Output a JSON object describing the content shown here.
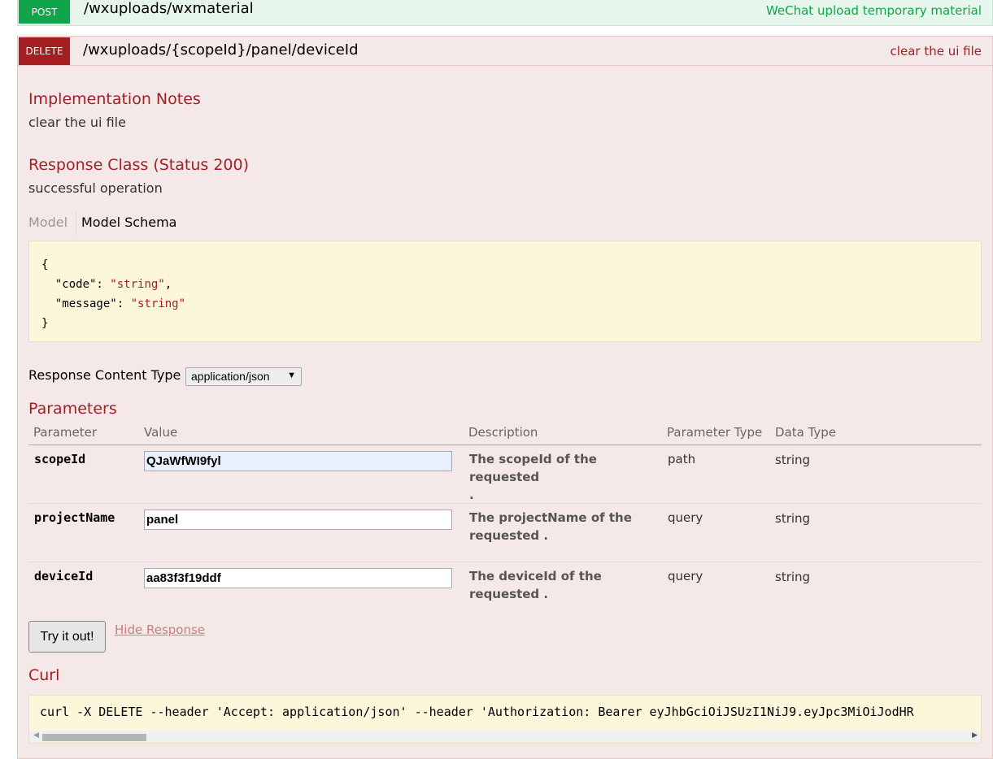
{
  "post_op": {
    "method": "POST",
    "path": "/wxuploads/wxmaterial",
    "summary": "WeChat upload temporary material"
  },
  "delete_op": {
    "method": "DELETE",
    "path": "/wxuploads/{scopeId}/panel/deviceId",
    "summary": "clear the ui file",
    "impl_notes_title": "Implementation Notes",
    "impl_notes_text": "clear the ui file",
    "response_class_title": "Response Class (Status 200)",
    "response_class_text": "successful operation",
    "tabs": {
      "model": "Model",
      "schema": "Model Schema"
    },
    "schema_lines": [
      "{",
      "  \"code\": ",
      "\"string\"",
      ",",
      "  \"message\": ",
      "\"string\"",
      "}"
    ],
    "response_content_type_label": "Response Content Type",
    "response_content_type_value": "application/json",
    "parameters_title": "Parameters",
    "param_headers": {
      "parameter": "Parameter",
      "value": "Value",
      "description": "Description",
      "parameter_type": "Parameter Type",
      "data_type": "Data Type"
    },
    "params": [
      {
        "name": "scopeId",
        "value": "QJaWfWI9fyl",
        "desc_line1": "The scopeId of the requested",
        "desc_line2": ".",
        "type": "path",
        "data_type": "string"
      },
      {
        "name": "projectName",
        "value": "panel",
        "desc_line1": "The projectName of the",
        "desc_line2": "requested .",
        "type": "query",
        "data_type": "string"
      },
      {
        "name": "deviceId",
        "value": "aa83f3f19ddf",
        "desc_line1": "The deviceId of the",
        "desc_line2": "requested .",
        "type": "query",
        "data_type": "string"
      }
    ],
    "try_button": "Try it out!",
    "hide_response": "Hide Response",
    "curl_title": "Curl",
    "curl_text": "curl -X DELETE --header 'Accept: application/json' --header 'Authorization: Bearer eyJhbGciOiJSUzI1NiJ9.eyJpc3MiOiJodHR"
  },
  "colors": {
    "post": "#10a54a",
    "delete": "#a41e22",
    "delete_bg": "#f5e8e8",
    "post_bg": "#e7f6ec",
    "schema_bg": "#fcf6db"
  }
}
